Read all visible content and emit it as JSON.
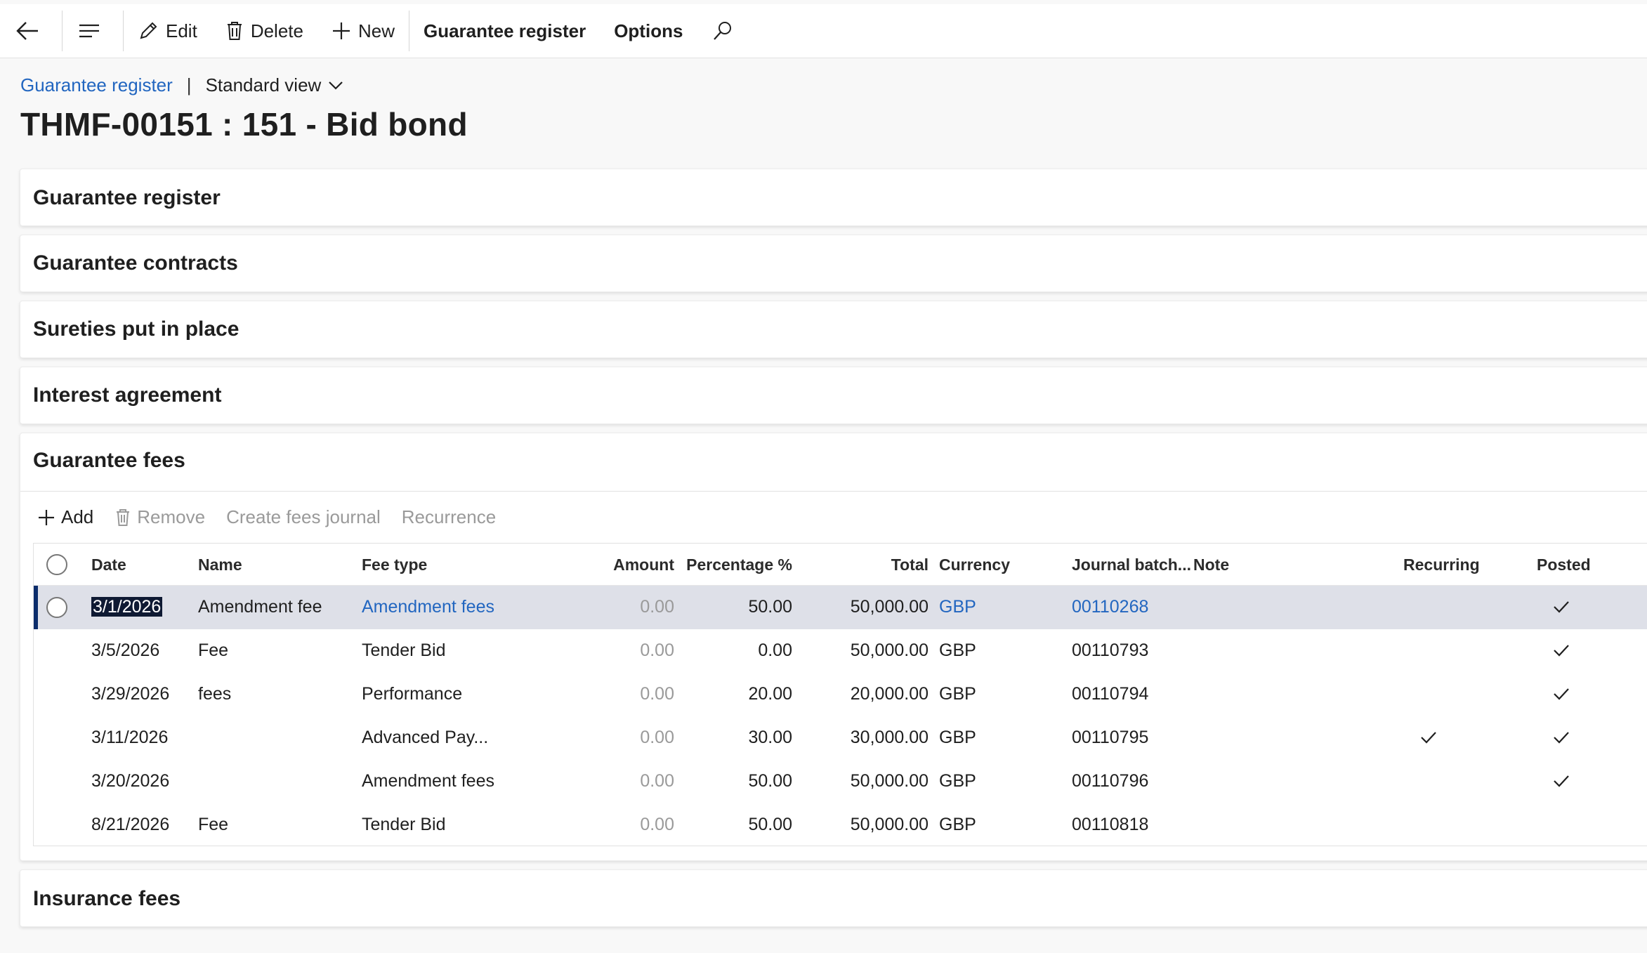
{
  "toolbar": {
    "edit": "Edit",
    "delete": "Delete",
    "new": "New",
    "guarantee_register": "Guarantee register",
    "options": "Options"
  },
  "breadcrumb": {
    "link": "Guarantee register",
    "view": "Standard view"
  },
  "page_title": "THMF-00151 : 151 - Bid bond",
  "sections": {
    "guarantee_register": "Guarantee register",
    "guarantee_contracts": "Guarantee contracts",
    "sureties": "Sureties put in place",
    "interest_agreement": "Interest agreement",
    "guarantee_fees": "Guarantee fees",
    "insurance_fees": "Insurance fees"
  },
  "fees_toolbar": {
    "add": "Add",
    "remove": "Remove",
    "create_fees_journal": "Create fees journal",
    "recurrence": "Recurrence"
  },
  "columns": {
    "date": "Date",
    "name": "Name",
    "fee_type": "Fee type",
    "amount": "Amount",
    "percentage": "Percentage %",
    "total": "Total",
    "currency": "Currency",
    "journal_batch": "Journal batch...",
    "note": "Note",
    "recurring": "Recurring",
    "posted": "Posted"
  },
  "rows": [
    {
      "date": "3/1/2026",
      "name": "Amendment fee",
      "fee_type": "Amendment fees",
      "amount": "0.00",
      "percentage": "50.00",
      "total": "50,000.00",
      "currency": "GBP",
      "journal_batch": "00110268",
      "note": "",
      "recurring": false,
      "posted": true
    },
    {
      "date": "3/5/2026",
      "name": "Fee",
      "fee_type": "Tender Bid",
      "amount": "0.00",
      "percentage": "0.00",
      "total": "50,000.00",
      "currency": "GBP",
      "journal_batch": "00110793",
      "note": "",
      "recurring": false,
      "posted": true
    },
    {
      "date": "3/29/2026",
      "name": "fees",
      "fee_type": "Performance",
      "amount": "0.00",
      "percentage": "20.00",
      "total": "20,000.00",
      "currency": "GBP",
      "journal_batch": "00110794",
      "note": "",
      "recurring": false,
      "posted": true
    },
    {
      "date": "3/11/2026",
      "name": "",
      "fee_type": "Advanced Pay...",
      "amount": "0.00",
      "percentage": "30.00",
      "total": "30,000.00",
      "currency": "GBP",
      "journal_batch": "00110795",
      "note": "",
      "recurring": true,
      "posted": true
    },
    {
      "date": "3/20/2026",
      "name": "",
      "fee_type": "Amendment fees",
      "amount": "0.00",
      "percentage": "50.00",
      "total": "50,000.00",
      "currency": "GBP",
      "journal_batch": "00110796",
      "note": "",
      "recurring": false,
      "posted": true
    },
    {
      "date": "8/21/2026",
      "name": "Fee",
      "fee_type": "Tender Bid",
      "amount": "0.00",
      "percentage": "50.00",
      "total": "50,000.00",
      "currency": "GBP",
      "journal_batch": "00110818",
      "note": "",
      "recurring": false,
      "posted": false
    }
  ],
  "colors": {
    "link": "#2266c0",
    "selected_row": "#dee0e8",
    "selected_indicator": "#0b2c6b"
  }
}
